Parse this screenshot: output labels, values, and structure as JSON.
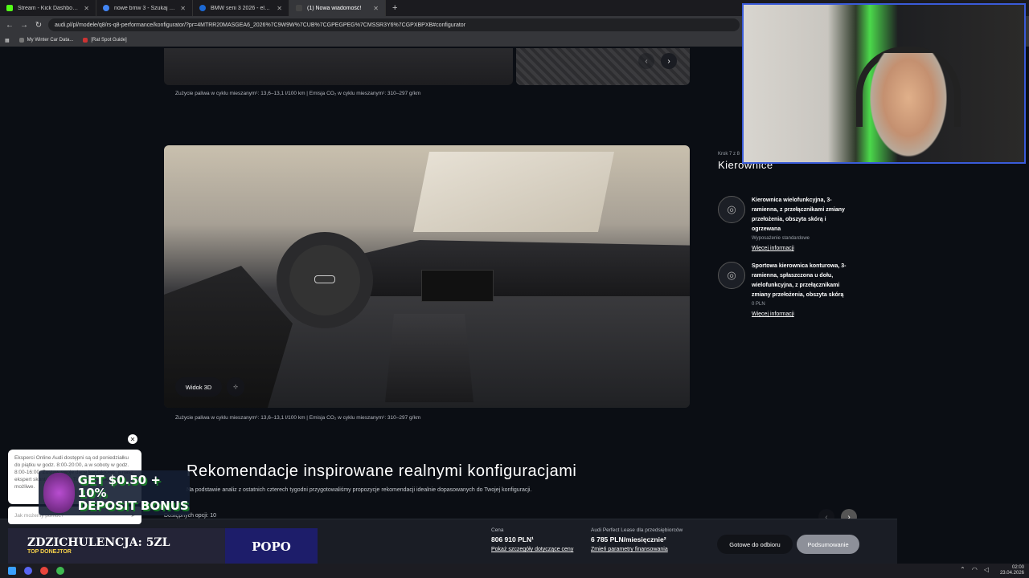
{
  "browser": {
    "tabs": [
      {
        "title": "Stream - Kick Dashboard",
        "color": "#53fc18",
        "active": false
      },
      {
        "title": "nowe bmw 3 - Szukaj w Google",
        "color": "#4285f4",
        "active": false
      },
      {
        "title": "BMW serii 3 2026 - elektryczne",
        "color": "#1c69d4",
        "active": false
      },
      {
        "title": "(1) Nowa wiadomość!",
        "color": "#444444",
        "active": true
      }
    ],
    "url": "audi.pl/pl/modele/q8/rs-q8-performance/konfigurator/?pr=4MTRR20MASGEA6_2026%7C9W9W%7CUB%7CGPEGPEG%7CMSSR3Y6%7CGPXBPXB#configurator",
    "bookmarks": [
      "My Winter Car Data...",
      "[Rat Spot Guide]"
    ]
  },
  "page": {
    "fuel_note": "Zużycie paliwa w cyklu mieszanym¹: 13,6–13,1 l/100 km | Emisja CO₂ w cyklu mieszanym¹: 310–297 g/km",
    "view3d_label": "Widok 3D",
    "view_icon_label": "⊹",
    "step_label": "Krok 7 z 8",
    "section_title": "Kierownice",
    "options": [
      {
        "name": "Kierownica wielofunkcyjna, 3-ramienna, z przełącznikami zmiany przełożenia, obszyta skórą i ogrzewana",
        "sub": "Wyposażenie standardowe",
        "more": "Więcej informacji"
      },
      {
        "name": "Sportowa kierownica konturowa, 3-ramienna, spłaszczona u dołu, wielofunkcyjna, z przełącznikami zmiany przełożenia, obszyta skórą",
        "sub": "0 PLN",
        "more": "Więcej informacji"
      }
    ],
    "reco_title": "Rekomendacje inspirowane realnymi konfiguracjami",
    "reco_desc": "Na podstawie analiz z ostatnich czterech tygodni przygotowaliśmy propozycje rekomendacji idealnie dopasowanych do Twojej konfiguracji.",
    "available": "Dostępnych opcji: 10"
  },
  "bottom_bar": {
    "price_label": "Cena",
    "price_value": "806 910 PLN¹",
    "price_link": "Pokaż szczegóły dotyczące ceny",
    "lease_label": "Audi Perfect Lease dla przedsiębiorców",
    "lease_value": "6 785 PLN/miesięcznie²",
    "lease_link": "Zmień parametry finansowania",
    "btn_pickup": "Gotowe do odbioru",
    "btn_summary": "Podsumowanie"
  },
  "chat": {
    "text": "Eksperci Online Audi dostępni są od poniedziałku do piątku w godz. 8:00-20:00, a w soboty w godz. 8:00-16:00. Zostaw swoje dane kontaktowe, a nasz ekspert skontaktuje się z Tobą tak szybko, jak to możliwe.",
    "placeholder": "Jak możemy pomóc?"
  },
  "overlay": {
    "promo_line1": "GET $0.50 + 10%",
    "promo_line2": "DEPOSIT BONUS",
    "donor_main": "ZDZICHULENCJA: 5ZL",
    "donor_sub": "TOP DONEJTOR",
    "donor_right": "POPO"
  },
  "taskbar": {
    "time": "02:00",
    "date": "23.04.2026"
  }
}
